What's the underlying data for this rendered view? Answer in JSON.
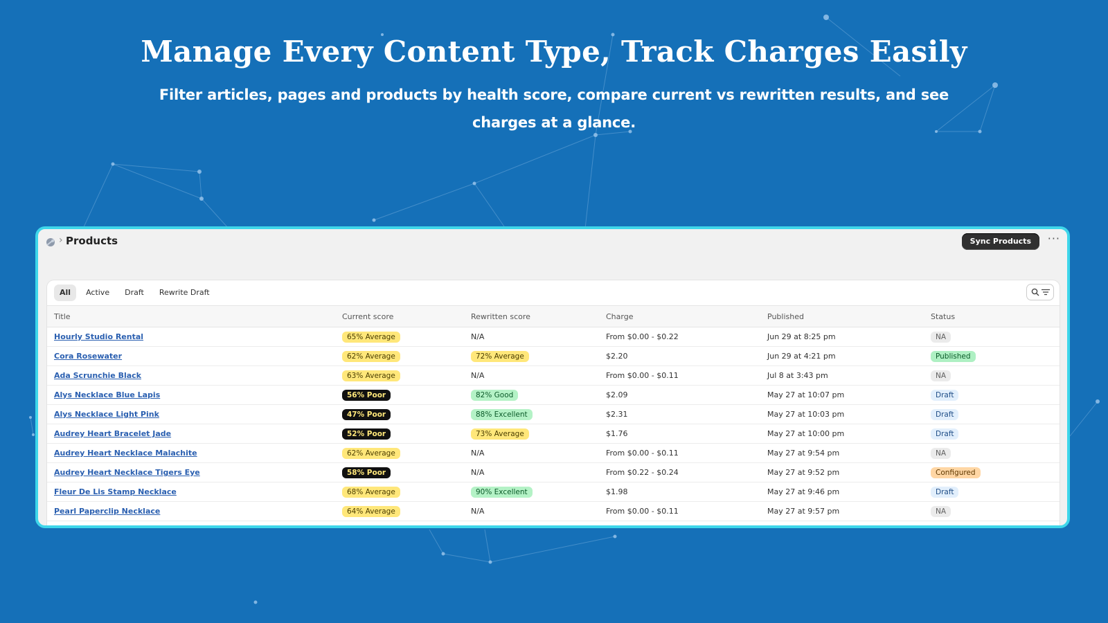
{
  "hero": {
    "title": "Manage Every Content Type, Track Charges Easily",
    "subtitle": "Filter articles, pages and products by health score, compare current vs rewritten results, and see charges at a glance."
  },
  "topbar": {
    "page_title": "Products",
    "sync_label": "Sync Products",
    "more_label": "···"
  },
  "tabs": [
    "All",
    "Active",
    "Draft",
    "Rewrite Draft"
  ],
  "columns": [
    "Title",
    "Current score",
    "Rewritten score",
    "Charge",
    "Published",
    "Status"
  ],
  "rows": [
    {
      "title": "Hourly Studio Rental",
      "current": "65% Average",
      "current_type": "avg",
      "rewritten": "N/A",
      "rewritten_type": "",
      "charge": "From $0.00 - $0.22",
      "published": "Jun 29 at 8:25 pm",
      "status": "NA",
      "status_type": "na"
    },
    {
      "title": "Cora Rosewater",
      "current": "62% Average",
      "current_type": "avg",
      "rewritten": "72% Average",
      "rewritten_type": "avg",
      "charge": "$2.20",
      "published": "Jun 29 at 4:21 pm",
      "status": "Published",
      "status_type": "pub"
    },
    {
      "title": "Ada Scrunchie Black",
      "current": "63% Average",
      "current_type": "avg",
      "rewritten": "N/A",
      "rewritten_type": "",
      "charge": "From $0.00 - $0.11",
      "published": "Jul 8 at 3:43 pm",
      "status": "NA",
      "status_type": "na"
    },
    {
      "title": "Alys Necklace Blue Lapis",
      "current": "56% Poor",
      "current_type": "poor",
      "rewritten": "82% Good",
      "rewritten_type": "good",
      "charge": "$2.09",
      "published": "May 27 at 10:07 pm",
      "status": "Draft",
      "status_type": "draft"
    },
    {
      "title": "Alys Necklace Light Pink",
      "current": "47% Poor",
      "current_type": "poor",
      "rewritten": "88% Excellent",
      "rewritten_type": "exc",
      "charge": "$2.31",
      "published": "May 27 at 10:03 pm",
      "status": "Draft",
      "status_type": "draft"
    },
    {
      "title": "Audrey Heart Bracelet Jade",
      "current": "52% Poor",
      "current_type": "poor",
      "rewritten": "73% Average",
      "rewritten_type": "avg",
      "charge": "$1.76",
      "published": "May 27 at 10:00 pm",
      "status": "Draft",
      "status_type": "draft"
    },
    {
      "title": "Audrey Heart Necklace Malachite",
      "current": "62% Average",
      "current_type": "avg",
      "rewritten": "N/A",
      "rewritten_type": "",
      "charge": "From $0.00 - $0.11",
      "published": "May 27 at 9:54 pm",
      "status": "NA",
      "status_type": "na"
    },
    {
      "title": "Audrey Heart Necklace Tigers Eye",
      "current": "58% Poor",
      "current_type": "poor",
      "rewritten": "N/A",
      "rewritten_type": "",
      "charge": "From $0.22 - $0.24",
      "published": "May 27 at 9:52 pm",
      "status": "Configured",
      "status_type": "conf"
    },
    {
      "title": "Fleur De Lis Stamp Necklace",
      "current": "68% Average",
      "current_type": "avg",
      "rewritten": "90% Excellent",
      "rewritten_type": "exc",
      "charge": "$1.98",
      "published": "May 27 at 9:46 pm",
      "status": "Draft",
      "status_type": "draft"
    },
    {
      "title": "Pearl Paperclip Necklace",
      "current": "64% Average",
      "current_type": "avg",
      "rewritten": "N/A",
      "rewritten_type": "",
      "charge": "From $0.00 - $0.11",
      "published": "May 27 at 9:57 pm",
      "status": "NA",
      "status_type": "na"
    }
  ],
  "colors": {
    "background": "#1570b8",
    "frame": "#3ed6ea",
    "link": "#2a5fb0"
  }
}
